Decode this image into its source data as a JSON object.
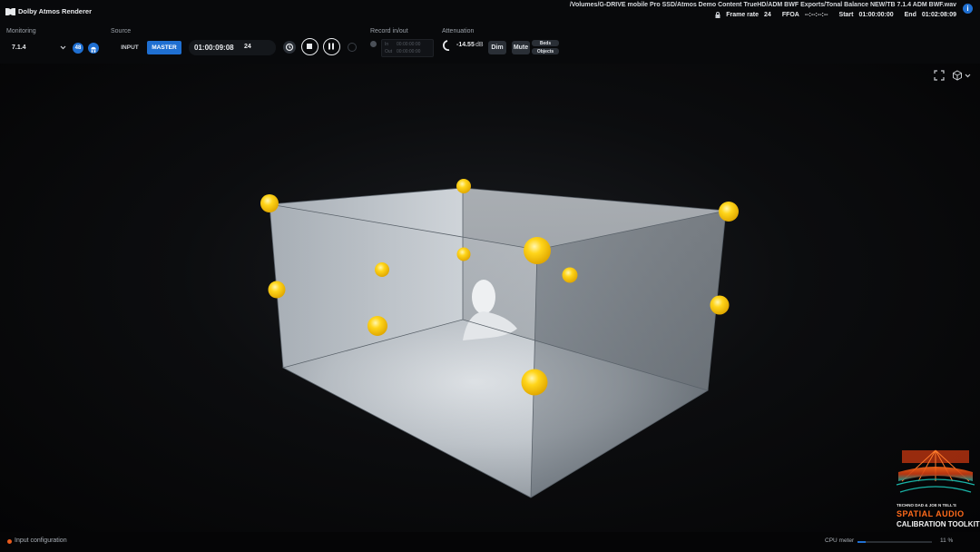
{
  "app": {
    "title": "Dolby Atmos Renderer"
  },
  "file_path": "/Volumes/G-DRIVE mobile Pro SSD/Atmos Demo Content TrueHD/ADM BWF Exports/Tonal Balance NEW/TB 7.1.4 ADM BWF.wav",
  "status": {
    "frame_rate_label": "Frame rate",
    "frame_rate": "24",
    "ffoa_label": "FFOA",
    "ffoa": "--:--:--:--",
    "start_label": "Start",
    "start": "01:00:00:00",
    "end_label": "End",
    "end": "01:02:08:09"
  },
  "monitoring": {
    "label": "Monitoring",
    "value": "7.1.4",
    "badge": "48"
  },
  "source": {
    "label": "Source",
    "input": "INPUT",
    "master": "MASTER",
    "timecode": "01:00:09:08",
    "fps": "24"
  },
  "record": {
    "label": "Record in/out",
    "in_label": "In",
    "out_label": "Out",
    "in_value": "00:00:00:00",
    "out_value": "00:00:00:00"
  },
  "attenuation": {
    "label": "Attenuation",
    "value": "-14.55",
    "unit": "dB",
    "dim": "Dim",
    "mute": "Mute",
    "beds": "Beds",
    "objects": "Objects"
  },
  "footer": {
    "input_config": "Input configuration",
    "cpu_label": "CPU meter",
    "cpu_value": "11 %",
    "cpu_fraction": 0.11
  },
  "watermark": {
    "line1": "TECHNO DAD & JOE N TELL'S",
    "line2": "SPATIAL AUDIO",
    "line3": "CALIBRATION TOOLKIT"
  },
  "colors": {
    "accent": "#1f6fd1",
    "speaker": "#f7c500",
    "record_dot": "#e85b1c"
  }
}
